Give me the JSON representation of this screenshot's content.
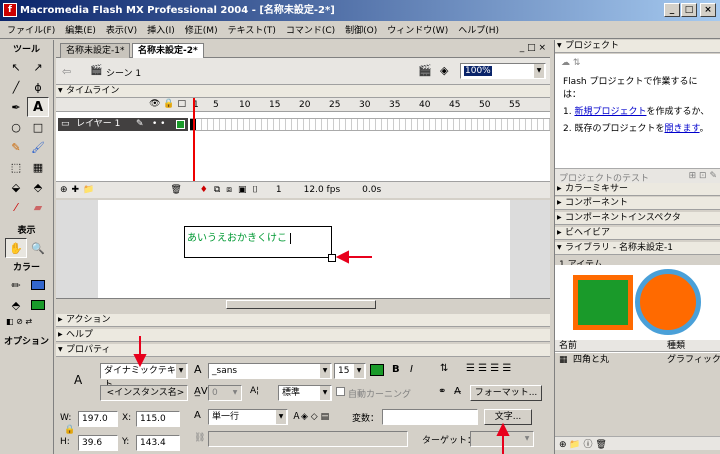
{
  "window": {
    "title": "Macromedia Flash MX Professional 2004 - [名称未設定-2*]"
  },
  "menu": [
    "ファイル(F)",
    "編集(E)",
    "表示(V)",
    "挿入(I)",
    "修正(M)",
    "テキスト(T)",
    "コマンド(C)",
    "制御(O)",
    "ウィンドウ(W)",
    "ヘルプ(H)"
  ],
  "tools": {
    "header": "ツール",
    "view_label": "表示",
    "color_label": "カラー",
    "options_label": "オプション"
  },
  "doc": {
    "tabs": [
      "名称未設定-1*",
      "名称未設定-2*"
    ],
    "scene": "シーン 1",
    "zoom": "100%"
  },
  "timeline": {
    "title": "タイムライン",
    "ruler": [
      "1",
      "5",
      "10",
      "15",
      "20",
      "25",
      "30",
      "35",
      "40",
      "45",
      "50",
      "55"
    ],
    "layer": "レイヤー 1",
    "frame": "1",
    "fps": "12.0 fps",
    "time": "0.0s"
  },
  "stage": {
    "text": "あいうえおかきくけこ"
  },
  "panels": {
    "action": "アクション",
    "help": "ヘルプ",
    "properties": "プロパティ"
  },
  "props": {
    "text_type": "ダイナミックテキスト",
    "instance": "<インスタンス名>",
    "font": "_sans",
    "size": "15",
    "bold": "B",
    "italic": "I",
    "tracking": "0",
    "antialias": "標準",
    "autokern": "自動カーニング",
    "format_btn": "フォーマット...",
    "line_type": "単一行",
    "var_label": "変数：",
    "char_btn": "文字...",
    "target_label": "ターゲット：",
    "w_label": "W:",
    "w": "197.0",
    "h_label": "H:",
    "h": "39.6",
    "x_label": "X:",
    "x": "115.0",
    "y_label": "Y:",
    "y": "143.4"
  },
  "right": {
    "project_title": "プロジェクト",
    "project_intro": "Flash プロジェクトで作業するには：",
    "project_step1_link": "新規プロジェクト",
    "project_step1_rest": "を作成するか、",
    "project_step2_pre": "既存のプロジェクトを",
    "project_step2_link": "開きます",
    "project_step2_post": "。",
    "project_test": "プロジェクトのテスト",
    "color_mixer": "カラーミキサー",
    "components": "コンポーネント",
    "comp_inspector": "コンポーネントインスペクタ",
    "behaviors": "ビヘイビア",
    "library": "ライブラリ - 名称未設定-1",
    "item_count": "1 アイテム",
    "col_name": "名前",
    "col_kind": "種類",
    "item_name": "四角と丸",
    "item_kind": "グラフィック"
  },
  "colors": {
    "accent_red": "#e8001c",
    "text_green": "#009933",
    "lib_green": "#1a9a2a",
    "lib_orange": "#ff6a00",
    "lib_blue": "#4aa0d8"
  }
}
